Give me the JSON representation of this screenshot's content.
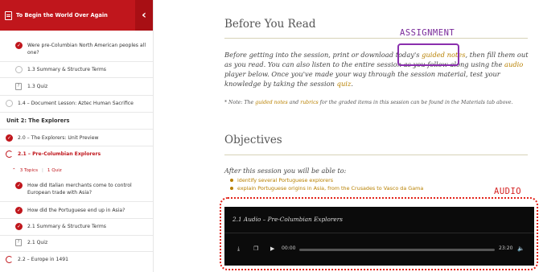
{
  "sidebar": {
    "header_title": "To Begin the World Over Again",
    "collapse_icon": "chevron-left-icon",
    "rows": [
      {
        "text": "Were pre-Columbian North American peoples all one?",
        "status": "complete"
      },
      {
        "text": "1.3 Summary & Structure Terms",
        "status": "incomplete"
      },
      {
        "text": "1.3 Quiz",
        "status": "quiz"
      },
      {
        "text": "1.4 – Document Lesson: Aztec Human Sacrifice",
        "status": "incomplete"
      },
      {
        "text": "Unit 2: The Explorers",
        "status": "section"
      },
      {
        "text": "2.0 – The Explorers: Unit Preview",
        "status": "complete"
      },
      {
        "text": "2.1 – Pre-Columbian Explorers",
        "status": "current"
      },
      {
        "text": "How did Italian merchants come to control European trade with Asia?",
        "status": "complete"
      },
      {
        "text": "How did the Portuguese end up in Asia?",
        "status": "complete"
      },
      {
        "text": "2.1 Summary & Structure Terms",
        "status": "complete"
      },
      {
        "text": "2.1 Quiz",
        "status": "quiz"
      },
      {
        "text": "2.2 – Europe in 1491",
        "status": "partial"
      }
    ],
    "meta": {
      "topics": "3 Topics",
      "quizzes": "1 Quiz"
    }
  },
  "main": {
    "before_heading": "Before You Read",
    "intro": {
      "t1": "Before getting into the session, print or download today's ",
      "guided_notes": "guided notes",
      "t2": ", then fill them out as you read. You can also listen to the entire session as you follow along using the ",
      "audio": "audio",
      "t3": " player below. Once you've made your way through the session material, test your knowledge by taking the session ",
      "quiz": "quiz",
      "t4": "."
    },
    "note": {
      "t1": "* Note: The ",
      "guided_notes": "guided notes",
      "t2": " and ",
      "rubrics": "rubrics",
      "t3": " for the graded items in this session can be found in the Materials tab above."
    },
    "objectives_heading": "Objectives",
    "after_text": "After this session you will be able to:",
    "objectives": [
      "identify several Portuguese explorers",
      "explain Portuguese origins in Asia, from the Crusades to Vasco da Gama"
    ]
  },
  "annotations": {
    "assignment": "ASSIGNMENT",
    "audio": "AUDIO"
  },
  "player": {
    "title": "2.1 Audio – Pre-Columbian Explorers",
    "current_time": "00:00",
    "duration": "23:20",
    "progress": 0
  },
  "colors": {
    "brand_red": "#c0161c",
    "link_gold": "#b88000",
    "annotation_purple": "#8a2fae",
    "annotation_red": "#e2231a"
  }
}
